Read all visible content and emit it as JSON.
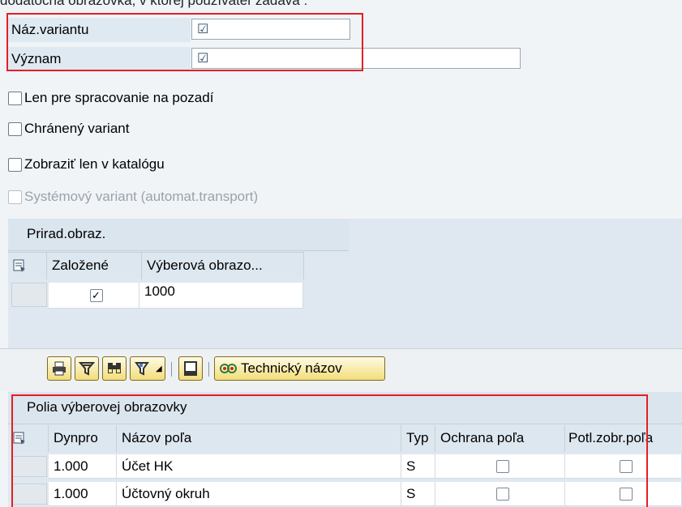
{
  "caption": "dodatočná obrazovka, v ktorej používateľ zadáva :",
  "fields": {
    "variant_name_label": "Náz.variantu",
    "meaning_label": "Význam"
  },
  "options": {
    "background_only": "Len pre spracovanie na pozadí",
    "protected_variant": "Chránený variant",
    "catalog_only": "Zobraziť len v katalógu",
    "system_variant": "Systémový variant (automat.transport)"
  },
  "screen_assignment": {
    "title": "Prirad.obraz.",
    "columns": [
      "Založené",
      "Výberová obrazo..."
    ],
    "rows": [
      {
        "created": true,
        "screen": "1000"
      }
    ]
  },
  "toolbar": {
    "technical_name_label": "Technický názov",
    "icons": [
      "print-icon",
      "filter-icon",
      "find-icon",
      "set-filter-icon",
      "export-icon"
    ]
  },
  "selection_fields": {
    "title": "Polia výberovej obrazovky",
    "columns": [
      "Dynpro",
      "Názov poľa",
      "Typ",
      "Ochrana poľa",
      "Potl.zobr.poľa"
    ],
    "rows": [
      {
        "dynpro": "1.000",
        "name": "Účet HK",
        "type": "S",
        "protect": false,
        "hide": false
      },
      {
        "dynpro": "1.000",
        "name": "Účtovný okruh",
        "type": "S",
        "protect": false,
        "hide": false
      }
    ]
  },
  "colors": {
    "highlight": "#e41e26",
    "toolbar_button": "#f2dd7a"
  }
}
